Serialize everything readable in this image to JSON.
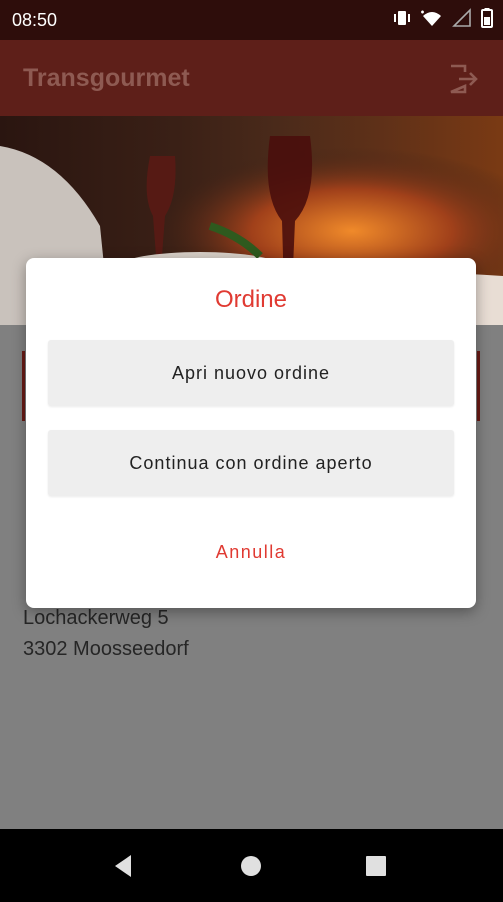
{
  "status_bar": {
    "time": "08:50"
  },
  "app_bar": {
    "title": "Transgourmet"
  },
  "address": {
    "street": "Lochackerweg 5",
    "city": "3302 Moosseedorf"
  },
  "dialog": {
    "title": "Ordine",
    "new_order_label": "Apri nuovo ordine",
    "continue_order_label": "Continua con ordine aperto",
    "cancel_label": "Annulla"
  },
  "colors": {
    "accent": "#e03a32",
    "app_bar": "#5e1f19",
    "status_bar": "#2e0d0b"
  },
  "icons": {
    "status": [
      "vibrate-icon",
      "wifi-icon",
      "signal-icon",
      "battery-icon"
    ],
    "app_bar": "logout-icon",
    "nav": [
      "back-icon",
      "home-icon",
      "recents-icon"
    ]
  }
}
